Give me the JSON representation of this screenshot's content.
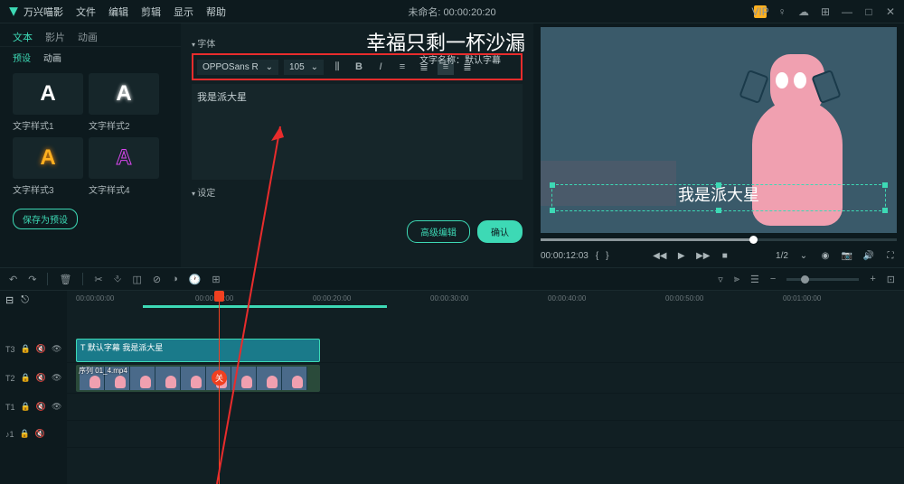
{
  "titlebar": {
    "app_name": "万兴喵影",
    "menus": [
      "文件",
      "编辑",
      "剪辑",
      "显示",
      "帮助"
    ],
    "doc_title": "未命名: 00:00:20:20",
    "vip": "VIP"
  },
  "overlay": {
    "title": "幸福只剩一杯沙漏",
    "sub": "文字名称：默认字幕"
  },
  "left": {
    "tabs": [
      "文本",
      "影片",
      "动画"
    ],
    "subtabs": [
      "预设",
      "动画"
    ],
    "styles": [
      {
        "letter": "A",
        "label": "文字样式1",
        "cls": "s1"
      },
      {
        "letter": "A",
        "label": "文字样式2",
        "cls": "s2"
      },
      {
        "letter": "A",
        "label": "文字样式3",
        "cls": "s3"
      },
      {
        "letter": "A",
        "label": "文字样式4",
        "cls": "s4"
      }
    ],
    "save_preset": "保存为预设"
  },
  "mid": {
    "section_font": "字体",
    "font_name": "OPPOSans R",
    "font_size": "105",
    "text_value": "我是派大星",
    "section_settings": "设定",
    "adv": "高级编辑",
    "ok": "确认"
  },
  "preview": {
    "overlay_text": "我是派大星",
    "timecode": "00:00:12:03",
    "scale": "1/2"
  },
  "ruler": [
    "00:00:00:00",
    "00:00:10:00",
    "00:00:20:00",
    "00:00:30:00",
    "00:00:40:00",
    "00:00:50:00",
    "00:01:00:00"
  ],
  "tracks": {
    "t3": "T3",
    "t2": "T2",
    "t1": "T1",
    "a1": "♪1",
    "text_clip": "T  默认字幕 我是派大星",
    "video_clip": "序列 01_4.mp4",
    "playhead_mark": "关"
  }
}
